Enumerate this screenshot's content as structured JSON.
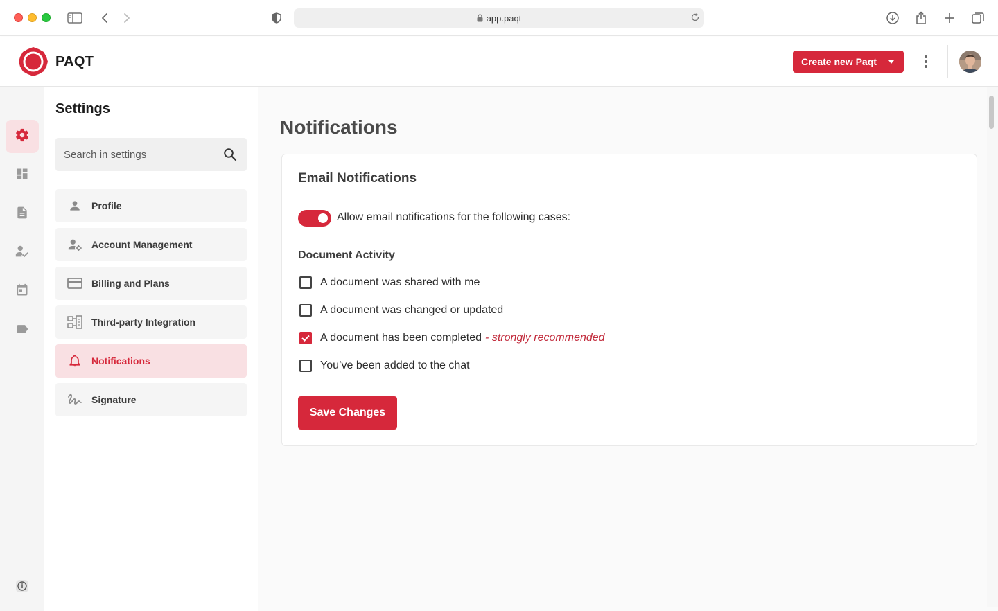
{
  "browser": {
    "url": "app.paqt"
  },
  "header": {
    "brand": "PAQT",
    "create_button": "Create new Paqt"
  },
  "rail": {
    "items": [
      {
        "icon": "gear-icon",
        "active": true
      },
      {
        "icon": "dashboard-icon",
        "active": false
      },
      {
        "icon": "document-icon",
        "active": false
      },
      {
        "icon": "user-check-icon",
        "active": false
      },
      {
        "icon": "calendar-icon",
        "active": false
      },
      {
        "icon": "tag-icon",
        "active": false
      }
    ]
  },
  "settings": {
    "title": "Settings",
    "search_placeholder": "Search in settings",
    "nav": [
      {
        "label": "Profile",
        "icon": "person-icon"
      },
      {
        "label": "Account Management",
        "icon": "user-gear-icon"
      },
      {
        "label": "Billing and Plans",
        "icon": "credit-card-icon"
      },
      {
        "label": "Third-party Integration",
        "icon": "integration-icon"
      },
      {
        "label": "Notifications",
        "icon": "bell-icon",
        "active": true
      },
      {
        "label": "Signature",
        "icon": "signature-icon"
      }
    ]
  },
  "main": {
    "page_title": "Notifications",
    "card": {
      "title": "Email Notifications",
      "toggle_label": "Allow email notifications for the following cases:",
      "toggle_on": true,
      "section_title": "Document Activity",
      "options": [
        {
          "label": "A document was shared with me",
          "checked": false
        },
        {
          "label": "A document was changed or updated",
          "checked": false
        },
        {
          "label": "A document has been completed",
          "note": "- strongly recommended",
          "checked": true
        },
        {
          "label": "You’ve been added to the chat",
          "checked": false
        }
      ],
      "save_button": "Save Changes"
    }
  },
  "colors": {
    "accent": "#d6283b",
    "accent_light": "#f9e0e3"
  }
}
